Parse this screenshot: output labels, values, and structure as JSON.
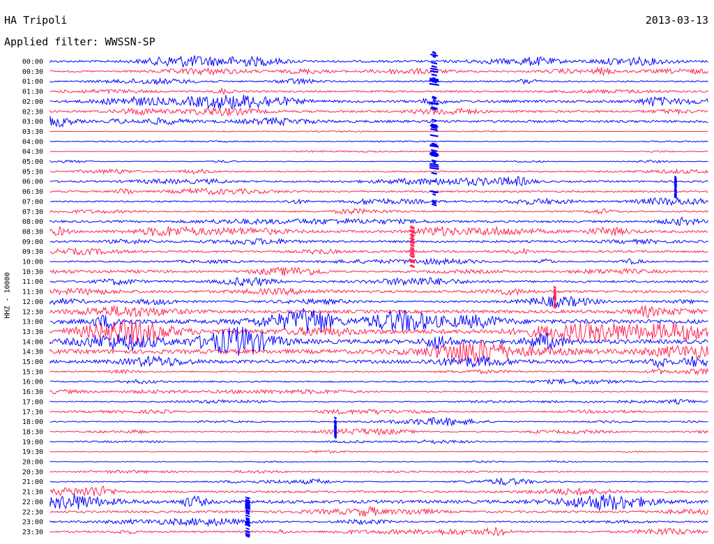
{
  "header": {
    "station": "HA Tripoli",
    "date": "2013-03-13",
    "filter": "Applied filter: WWSSN-SP"
  },
  "chart_data": {
    "type": "line",
    "title": "HA Tripoli",
    "ylabel": "HHZ - 10000",
    "row_labels": [
      "00:00",
      "00:30",
      "01:00",
      "01:30",
      "02:00",
      "02:30",
      "03:00",
      "03:30",
      "04:00",
      "04:30",
      "05:00",
      "05:30",
      "06:00",
      "06:30",
      "07:00",
      "07:30",
      "08:00",
      "08:30",
      "09:00",
      "09:30",
      "10:00",
      "10:30",
      "11:00",
      "11:30",
      "12:00",
      "12:30",
      "13:00",
      "13:30",
      "14:00",
      "14:30",
      "15:00",
      "15:30",
      "16:00",
      "16:30",
      "17:00",
      "17:30",
      "18:00",
      "18:30",
      "19:00",
      "19:30",
      "20:00",
      "20:30",
      "21:00",
      "21:30",
      "22:00",
      "22:30",
      "23:00",
      "23:30"
    ],
    "series_colors": [
      "#0000ff",
      "#ff2050"
    ],
    "row_amplitude": [
      6,
      5,
      4,
      5,
      7,
      6,
      7,
      1,
      2,
      1,
      2,
      4,
      5,
      5,
      4,
      4,
      6,
      7,
      6,
      6,
      4,
      4,
      6,
      7,
      5,
      9,
      12,
      13,
      12,
      12,
      9,
      4,
      4,
      3,
      3,
      3,
      3,
      3,
      2,
      2,
      2,
      2,
      3,
      6,
      9,
      6,
      4,
      5
    ],
    "events": [
      {
        "time": "02:00",
        "offset_min": 17.5,
        "amplitude": "very large",
        "duration_rows": 10
      },
      {
        "time": "08:30",
        "offset_min": 16.5,
        "amplitude": "large",
        "duration_rows": 3
      },
      {
        "time": "11:30",
        "offset_min": 23.0,
        "amplitude": "medium",
        "duration_rows": 1
      },
      {
        "time": "18:00",
        "offset_min": 13.0,
        "amplitude": "medium",
        "duration_rows": 1
      },
      {
        "time": "22:00",
        "offset_min": 9.0,
        "amplitude": "large",
        "duration_rows": 3
      },
      {
        "time": "06:00",
        "offset_min": 28.5,
        "amplitude": "medium",
        "duration_rows": 1
      }
    ]
  },
  "colors": {
    "background": "#ffffff",
    "trace_blue": "#0000ff",
    "trace_red": "#ff2050",
    "text": "#000000"
  }
}
